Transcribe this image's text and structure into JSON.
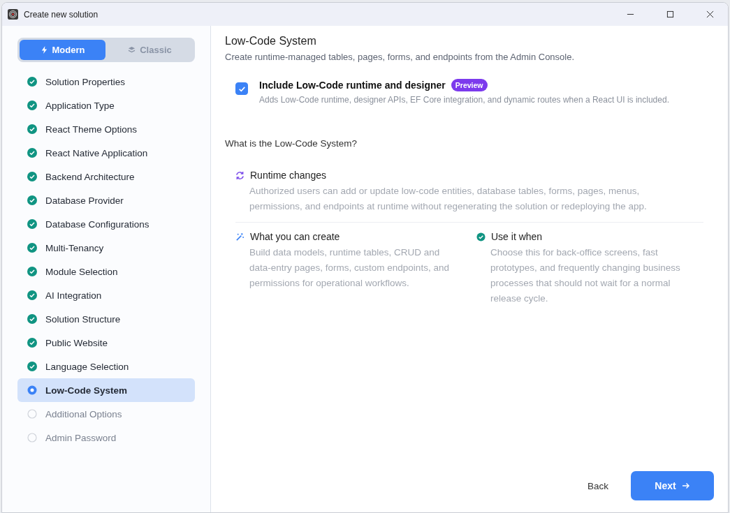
{
  "window": {
    "title": "Create new solution"
  },
  "mode_toggle": [
    {
      "label": "Modern",
      "selected": true
    },
    {
      "label": "Classic",
      "selected": false
    }
  ],
  "steps": [
    {
      "label": "Solution Properties",
      "completed": true,
      "selected": false
    },
    {
      "label": "Application Type",
      "completed": true,
      "selected": false
    },
    {
      "label": "React Theme Options",
      "completed": true,
      "selected": false
    },
    {
      "label": "React Native Application",
      "completed": true,
      "selected": false
    },
    {
      "label": "Backend Architecture",
      "completed": true,
      "selected": false
    },
    {
      "label": "Database Provider",
      "completed": true,
      "selected": false
    },
    {
      "label": "Database Configurations",
      "completed": true,
      "selected": false
    },
    {
      "label": "Multi-Tenancy",
      "completed": true,
      "selected": false
    },
    {
      "label": "Module Selection",
      "completed": true,
      "selected": false
    },
    {
      "label": "AI Integration",
      "completed": true,
      "selected": false
    },
    {
      "label": "Solution Structure",
      "completed": true,
      "selected": false
    },
    {
      "label": "Public Website",
      "completed": true,
      "selected": false
    },
    {
      "label": "Language Selection",
      "completed": true,
      "selected": false
    },
    {
      "label": "Low-Code System",
      "completed": false,
      "selected": true
    },
    {
      "label": "Additional Options",
      "completed": false,
      "selected": false
    },
    {
      "label": "Admin Password",
      "completed": false,
      "selected": false
    }
  ],
  "page": {
    "title": "Low-Code System",
    "subtitle": "Create runtime-managed tables, pages, forms, and endpoints from the Admin Console.",
    "option": {
      "label": "Include Low-Code runtime and designer",
      "badge": "Preview",
      "checked": true,
      "description": "Adds Low-Code runtime, designer APIs, EF Core integration, and dynamic routes when a React UI is included."
    },
    "section_title": "What is the Low-Code System?",
    "features": [
      {
        "kind": "refresh",
        "title": "Runtime changes",
        "text": "Authorized users can add or update low-code entities, database tables, forms, pages, menus, permissions, and endpoints at runtime without regenerating the solution or redeploying the app."
      },
      {
        "kind": "wand",
        "title": "What you can create",
        "text": "Build data models, runtime tables, CRUD and data-entry pages, forms, custom endpoints, and permissions for operational workflows."
      },
      {
        "kind": "check",
        "title": "Use it when",
        "text": "Choose this for back-office screens, fast prototypes, and frequently changing business processes that should not wait for a normal release cycle."
      }
    ]
  },
  "buttons": {
    "back": "Back",
    "next": "Next"
  }
}
